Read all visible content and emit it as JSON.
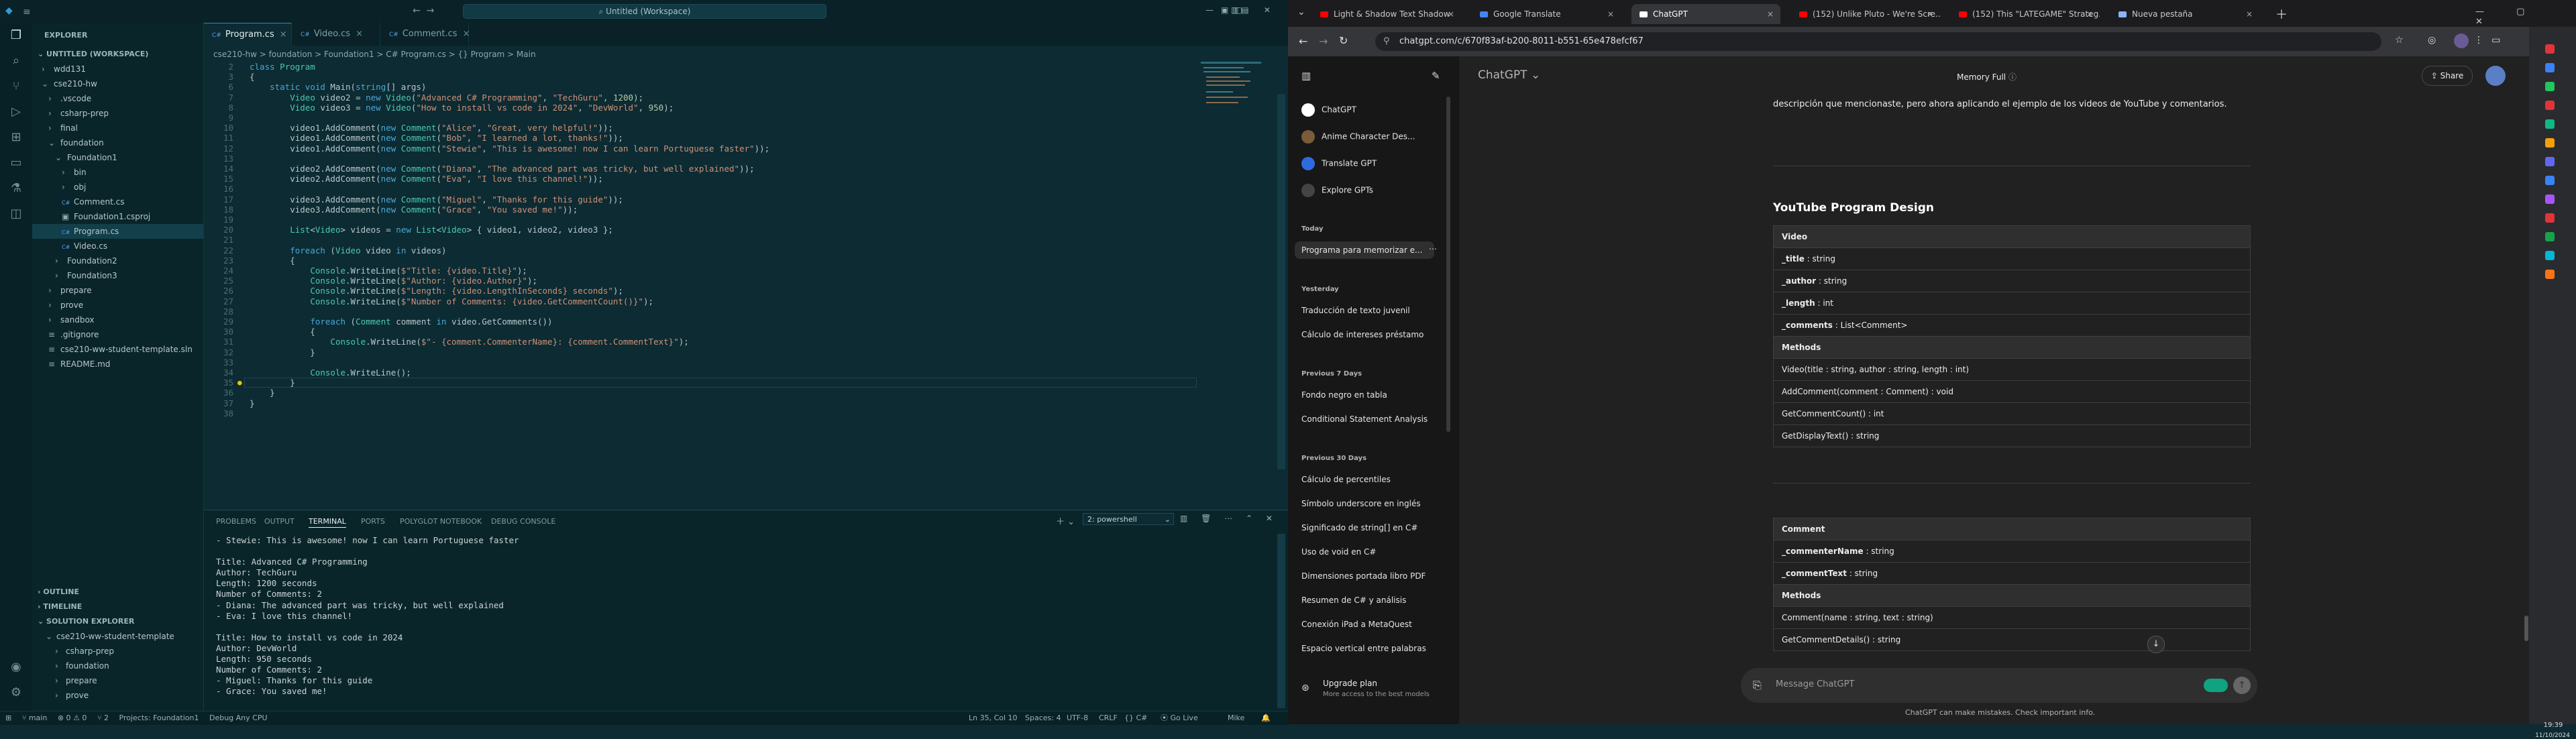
{
  "vscode": {
    "title": "Untitled (Workspace)",
    "explorer_label": "EXPLORER",
    "workspace_label": "UNTITLED (WORKSPACE)",
    "tree": [
      {
        "label": "wdd131",
        "indent": 0,
        "type": "folder"
      },
      {
        "label": "cse210-hw",
        "indent": 0,
        "type": "folder-open"
      },
      {
        "label": ".vscode",
        "indent": 1,
        "type": "folder"
      },
      {
        "label": "csharp-prep",
        "indent": 1,
        "type": "folder"
      },
      {
        "label": "final",
        "indent": 1,
        "type": "folder"
      },
      {
        "label": "foundation",
        "indent": 1,
        "type": "folder-open"
      },
      {
        "label": "Foundation1",
        "indent": 2,
        "type": "folder-open"
      },
      {
        "label": "bin",
        "indent": 3,
        "type": "folder"
      },
      {
        "label": "obj",
        "indent": 3,
        "type": "folder"
      },
      {
        "label": "Comment.cs",
        "indent": 3,
        "type": "cs"
      },
      {
        "label": "Foundation1.csproj",
        "indent": 3,
        "type": "proj"
      },
      {
        "label": "Program.cs",
        "indent": 3,
        "type": "cs",
        "selected": true
      },
      {
        "label": "Video.cs",
        "indent": 3,
        "type": "cs"
      },
      {
        "label": "Foundation2",
        "indent": 2,
        "type": "folder"
      },
      {
        "label": "Foundation3",
        "indent": 2,
        "type": "folder"
      },
      {
        "label": "prepare",
        "indent": 1,
        "type": "folder"
      },
      {
        "label": "prove",
        "indent": 1,
        "type": "folder"
      },
      {
        "label": "sandbox",
        "indent": 1,
        "type": "folder"
      },
      {
        "label": ".gitignore",
        "indent": 1,
        "type": "file"
      },
      {
        "label": "cse210-ww-student-template.sln",
        "indent": 1,
        "type": "file"
      },
      {
        "label": "README.md",
        "indent": 1,
        "type": "file"
      }
    ],
    "outline_label": "OUTLINE",
    "timeline_label": "TIMELINE",
    "solution_label": "SOLUTION EXPLORER",
    "solution_tree": [
      "cse210-ww-student-template",
      "csharp-prep",
      "foundation",
      "prepare",
      "prove"
    ],
    "tabs": [
      {
        "label": "Program.cs",
        "active": true
      },
      {
        "label": "Video.cs",
        "active": false
      },
      {
        "label": "Comment.cs",
        "active": false
      }
    ],
    "breadcrumb": "cse210-hw > foundation > Foundation1 > C# Program.cs > {} Program > Main",
    "code_lines": [
      {
        "n": "2",
        "t": "class Program"
      },
      {
        "n": "3",
        "t": "{"
      },
      {
        "n": "6",
        "t": "    static void Main(string[] args)"
      },
      {
        "n": "7",
        "t": "        Video video2 = new Video(\"Advanced C# Programming\", \"TechGuru\", 1200);"
      },
      {
        "n": "8",
        "t": "        Video video3 = new Video(\"How to install vs code in 2024\", \"DevWorld\", 950);"
      },
      {
        "n": "9",
        "t": ""
      },
      {
        "n": "10",
        "t": "        video1.AddComment(new Comment(\"Alice\", \"Great, very helpful!\"));"
      },
      {
        "n": "11",
        "t": "        video1.AddComment(new Comment(\"Bob\", \"I learned a lot, thanks!\"));"
      },
      {
        "n": "12",
        "t": "        video1.AddComment(new Comment(\"Stewie\", \"This is awesome! now I can learn Portuguese faster\"));"
      },
      {
        "n": "13",
        "t": ""
      },
      {
        "n": "14",
        "t": "        video2.AddComment(new Comment(\"Diana\", \"The advanced part was tricky, but well explained\"));"
      },
      {
        "n": "15",
        "t": "        video2.AddComment(new Comment(\"Eva\", \"I love this channel!\"));"
      },
      {
        "n": "16",
        "t": ""
      },
      {
        "n": "17",
        "t": "        video3.AddComment(new Comment(\"Miguel\", \"Thanks for this guide\"));"
      },
      {
        "n": "18",
        "t": "        video3.AddComment(new Comment(\"Grace\", \"You saved me!\"));"
      },
      {
        "n": "19",
        "t": ""
      },
      {
        "n": "20",
        "t": "        List<Video> videos = new List<Video> { video1, video2, video3 };"
      },
      {
        "n": "21",
        "t": ""
      },
      {
        "n": "22",
        "t": "        foreach (Video video in videos)"
      },
      {
        "n": "23",
        "t": "        {"
      },
      {
        "n": "24",
        "t": "            Console.WriteLine($\"Title: {video.Title}\");"
      },
      {
        "n": "25",
        "t": "            Console.WriteLine($\"Author: {video.Author}\");"
      },
      {
        "n": "26",
        "t": "            Console.WriteLine($\"Length: {video.LengthInSeconds} seconds\");"
      },
      {
        "n": "27",
        "t": "            Console.WriteLine($\"Number of Comments: {video.GetCommentCount()}\");"
      },
      {
        "n": "28",
        "t": ""
      },
      {
        "n": "29",
        "t": "            foreach (Comment comment in video.GetComments())"
      },
      {
        "n": "30",
        "t": "            {"
      },
      {
        "n": "31",
        "t": "                Console.WriteLine($\"- {comment.CommenterName}: {comment.CommentText}\");"
      },
      {
        "n": "32",
        "t": "            }"
      },
      {
        "n": "33",
        "t": ""
      },
      {
        "n": "34",
        "t": "            Console.WriteLine();"
      },
      {
        "n": "35",
        "t": "        }"
      },
      {
        "n": "36",
        "t": "    }"
      },
      {
        "n": "37",
        "t": "}"
      },
      {
        "n": "38",
        "t": ""
      }
    ],
    "panel_tabs": [
      "PROBLEMS",
      "OUTPUT",
      "TERMINAL",
      "PORTS",
      "POLYGLOT NOTEBOOK",
      "DEBUG CONSOLE"
    ],
    "panel_active": "TERMINAL",
    "terminal_select": "2: powershell",
    "terminal_lines": [
      "- Stewie: This is awesome! now I can learn Portuguese faster",
      "",
      "Title: Advanced C# Programming",
      "Author: TechGuru",
      "Length: 1200 seconds",
      "Number of Comments: 2",
      "- Diana: The advanced part was tricky, but well explained",
      "- Eva: I love this channel!",
      "",
      "Title: How to install vs code in 2024",
      "Author: DevWorld",
      "Length: 950 seconds",
      "Number of Comments: 2",
      "- Miguel: Thanks for this guide",
      "- Grace: You saved me!"
    ],
    "status": {
      "branch": "main",
      "errors": "⊗ 0 ⚠ 0",
      "ports": "⑂ 2",
      "project": "Projects: Foundation1",
      "debug": "Debug Any CPU",
      "position": "Ln 35, Col 10",
      "spaces": "Spaces: 4",
      "encoding": "UTF-8",
      "eol": "CRLF",
      "lang": "{} C#",
      "golive": "Go Live",
      "user": "Mike"
    }
  },
  "browser": {
    "tabs": [
      {
        "label": "Light & Shadow Text Shadow",
        "active": false,
        "icon": "youtube"
      },
      {
        "label": "Google Translate",
        "active": false,
        "icon": "translate"
      },
      {
        "label": "ChatGPT",
        "active": true,
        "icon": "openai"
      },
      {
        "label": "(152) Unlike Pluto - We're Scre...",
        "active": false,
        "icon": "youtube"
      },
      {
        "label": "(152) This \"LATEGAME\" Strateg...",
        "active": false,
        "icon": "youtube"
      },
      {
        "label": "Nueva pestaña",
        "active": false,
        "icon": "chrome"
      }
    ],
    "url": "chatgpt.com/c/670f83af-b200-8011-b551-65e478efcf67",
    "chatgpt": {
      "model": "ChatGPT",
      "memory": "Memory Full",
      "share": "Share",
      "nav": [
        "ChatGPT",
        "Anime Character Des...",
        "Translate GPT",
        "Explore GPTs"
      ],
      "sections": [
        {
          "title": "Today",
          "items": [
            "Programa para memorizar e..."
          ]
        },
        {
          "title": "Yesterday",
          "items": [
            "Traducción de texto juvenil",
            "Cálculo de intereses préstamo"
          ]
        },
        {
          "title": "Previous 7 Days",
          "items": [
            "Fondo negro en tabla",
            "Conditional Statement Analysis"
          ]
        },
        {
          "title": "Previous 30 Days",
          "items": [
            "Cálculo de percentiles",
            "Símbolo underscore en inglés",
            "Significado de string[] en C#",
            "Uso de void en C#",
            "Dimensiones portada libro PDF",
            "Resumen de C# y análisis",
            "Conexión iPad a MetaQuest",
            "Espacio vertical entre palabras"
          ]
        }
      ],
      "upgrade_title": "Upgrade plan",
      "upgrade_sub": "More access to the best models",
      "intro": "descripción que mencionaste, pero ahora aplicando el ejemplo de los videos de YouTube y comentarios.",
      "heading": "YouTube Program Design",
      "video_table": {
        "name": "Video",
        "attributes": [
          {
            "name": "_title",
            "type": "string"
          },
          {
            "name": "_author",
            "type": "string"
          },
          {
            "name": "_length",
            "type": "int"
          },
          {
            "name": "_comments",
            "type": "List<Comment>"
          }
        ],
        "methods_label": "Methods",
        "methods": [
          "Video(title : string, author : string, length : int)",
          "AddComment(comment : Comment) : void",
          "GetCommentCount() : int",
          "GetDisplayText() : string"
        ]
      },
      "comment_table": {
        "name": "Comment",
        "attributes": [
          {
            "name": "_commenterName",
            "type": "string"
          },
          {
            "name": "_commentText",
            "type": "string"
          }
        ],
        "methods_label": "Methods",
        "methods": [
          "Comment(name : string, text : string)",
          "GetCommentDetails() : string"
        ]
      },
      "composer_placeholder": "Message ChatGPT",
      "disclaimer": "ChatGPT can make mistakes. Check important info."
    }
  },
  "taskbar": {
    "time": "19:39",
    "date": "11/10/2024"
  },
  "colors": {
    "vscode_bg": "#0c2b33",
    "chatgpt_bg": "#212121",
    "accent": "#10a37f"
  }
}
